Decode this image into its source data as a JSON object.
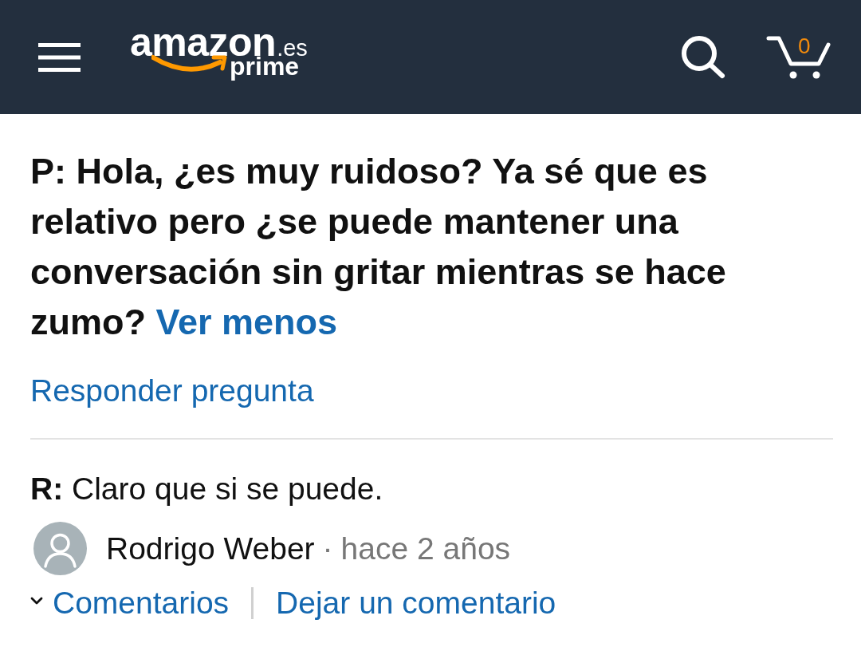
{
  "header": {
    "logo": {
      "wordmark": "amazon",
      "domain": ".es",
      "tier": "prime"
    },
    "cart_count": "0"
  },
  "question": {
    "text": "P: Hola, ¿es muy ruidoso? Ya sé que es relativo pero ¿se puede mantener una conversación sin gritar mientras se hace zumo?",
    "toggle_link": "Ver menos"
  },
  "answer_link": "Responder pregunta",
  "answer": {
    "text": "**R:** Claro que si se puede.",
    "author": "Rodrigo Weber",
    "separator": "·",
    "date": "hace 2 años"
  },
  "comments": {
    "label": "Comentarios",
    "expanded": false,
    "leave_link": "Dejar un comentario"
  }
}
